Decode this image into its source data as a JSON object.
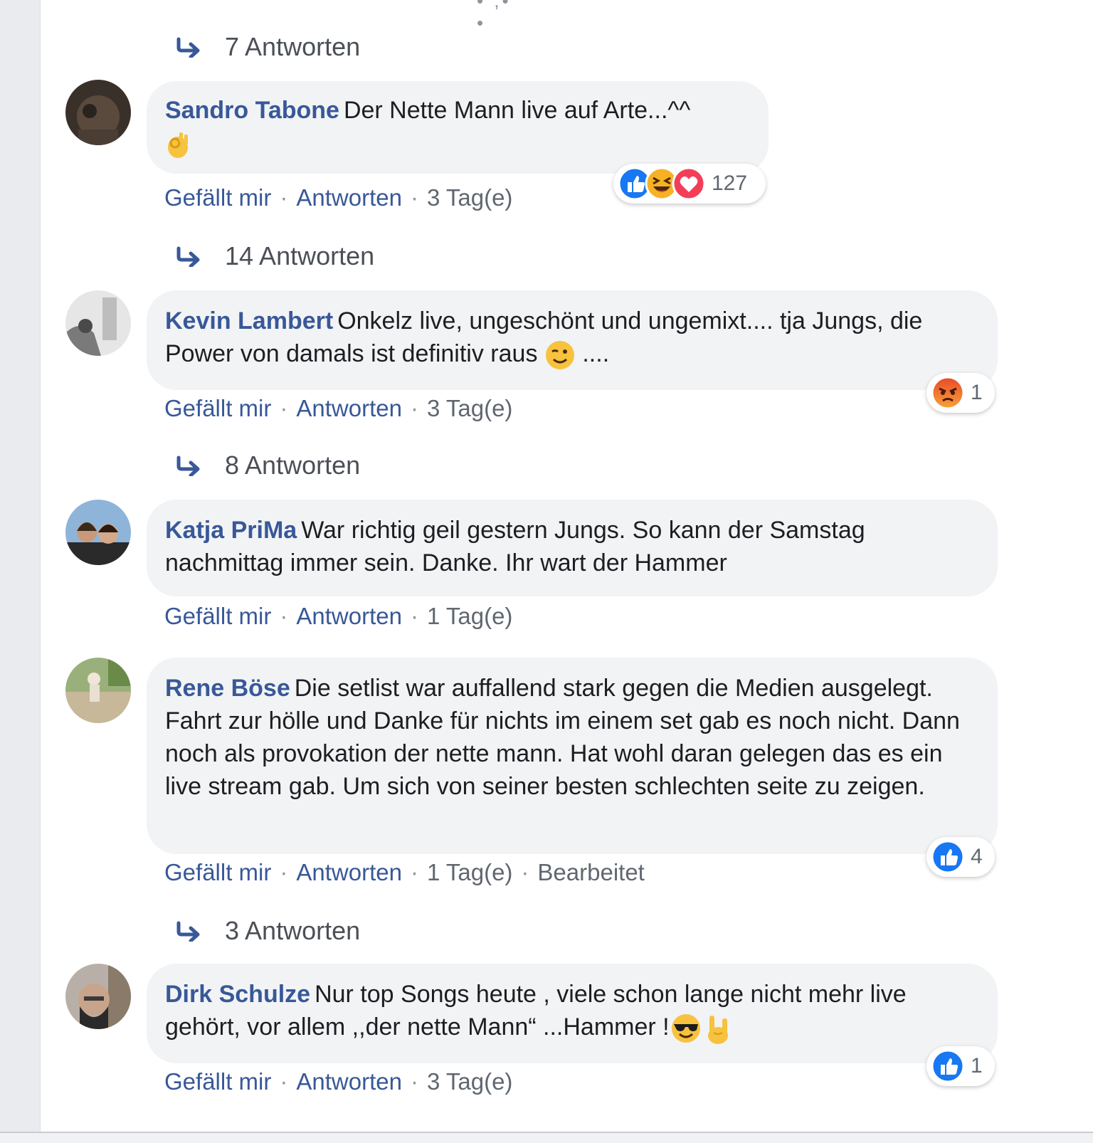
{
  "top_fragment": "• ,• •",
  "comments": [
    {
      "replies_before": "7 Antworten",
      "author": "Sandro Tabone",
      "text": "Der Nette Mann live auf Arte...^^",
      "trail_emoji": "ok-hand",
      "like": "Gefällt mir",
      "reply": "Antworten",
      "time": "3 Tag(e)",
      "reactions": [
        "like",
        "haha",
        "love"
      ],
      "reaction_count": "127"
    },
    {
      "replies_before": "14 Antworten",
      "author": "Kevin Lambert",
      "text": "Onkelz live, ungeschönt und ungemixt.... tja Jungs, die Power von damals ist definitiv raus",
      "text_after_emoji": " ....",
      "inline_emoji": "wink-face",
      "like": "Gefällt mir",
      "reply": "Antworten",
      "time": "3 Tag(e)",
      "reactions": [
        "angry"
      ],
      "reaction_count": "1"
    },
    {
      "replies_before": "8 Antworten",
      "author": "Katja PriMa",
      "text": "War richtig geil gestern Jungs. So kann der Samstag nachmittag immer sein. Danke. Ihr wart der Hammer",
      "like": "Gefällt mir",
      "reply": "Antworten",
      "time": "1 Tag(e)"
    },
    {
      "author": "Rene Böse",
      "text": "Die setlist war auffallend stark gegen die Medien ausgelegt. Fahrt zur hölle und Danke für nichts im einem set gab es noch nicht. Dann noch als provokation der nette mann. Hat wohl daran gelegen das es ein live stream gab. Um sich von seiner besten schlechten seite zu zeigen.",
      "like": "Gefällt mir",
      "reply": "Antworten",
      "time": "1 Tag(e)",
      "edited": "Bearbeitet",
      "reactions": [
        "like"
      ],
      "reaction_count": "4"
    },
    {
      "replies_before": "3 Antworten",
      "author": "Dirk Schulze",
      "text": "Nur top Songs heute , viele schon lange nicht mehr live gehört, vor allem ,,der nette Mann“ ...Hammer !",
      "inline_emoji": [
        "sunglasses-face",
        "horns-hand"
      ],
      "like": "Gefällt mir",
      "reply": "Antworten",
      "time": "3 Tag(e)",
      "reactions": [
        "like"
      ],
      "reaction_count": "1"
    }
  ],
  "colors": {
    "author": "#385898",
    "bubble": "#f2f3f5",
    "meta": "#606770",
    "like_blue": "#1877f2",
    "angry_orange": "#f0642a"
  }
}
